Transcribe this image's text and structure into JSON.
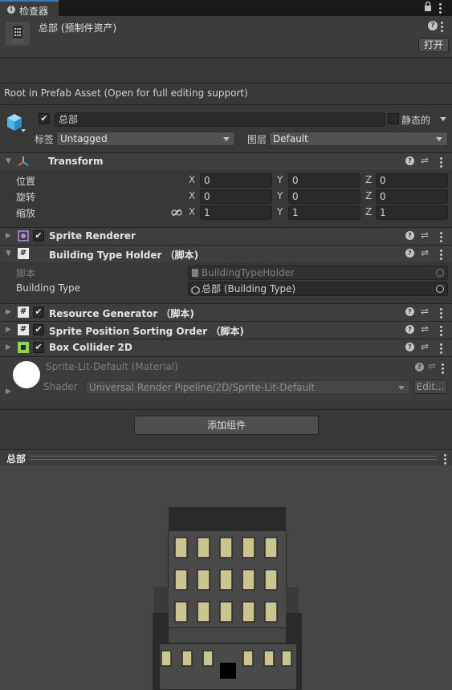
{
  "tab": {
    "icon": "info-icon",
    "label": "检查器"
  },
  "tabbar_icons": [
    "lock-icon",
    "kebab-menu-icon"
  ],
  "asset": {
    "name": "总部 (预制件资产)",
    "open_button": "打开",
    "help_icon": "help-icon"
  },
  "prefab_notice": "Root in Prefab Asset (Open for full editing support)",
  "gameobject": {
    "active": true,
    "name": "总部",
    "static_label": "静态的",
    "tag_label": "标签",
    "tag_value": "Untagged",
    "layer_label": "图层",
    "layer_value": "Default"
  },
  "transform": {
    "title": "Transform",
    "rows": [
      {
        "label": "位置",
        "x": "0",
        "y": "0",
        "z": "0"
      },
      {
        "label": "旋转",
        "x": "0",
        "y": "0",
        "z": "0"
      },
      {
        "label": "缩放",
        "x": "1",
        "y": "1",
        "z": "1"
      }
    ],
    "axis_labels": [
      "X",
      "Y",
      "Z"
    ]
  },
  "components": {
    "sprite_renderer": "Sprite Renderer",
    "building_type_holder": "Building Type Holder （脚本)",
    "script_label": "脚本",
    "script_value": "BuildingTypeHolder",
    "building_type_label": "Building Type",
    "building_type_value": "总部 (Building Type)",
    "resource_generator": "Resource Generator （脚本)",
    "sprite_position_sorting": "Sprite Position Sorting Order （脚本)",
    "box_collider": "Box Collider 2D"
  },
  "material": {
    "name": "Sprite-Lit-Default (Material)",
    "shader_label": "Shader",
    "shader_value": "Universal Render Pipeline/2D/Sprite-Lit-Default",
    "edit_button": "Edit..."
  },
  "add_component": "添加组件",
  "preview": {
    "title": "总部"
  },
  "colors": {
    "background": "#383838",
    "window_accent": "#cdc590",
    "building_dark": "#4a4a4a",
    "building_darker": "#2a2a2a"
  }
}
